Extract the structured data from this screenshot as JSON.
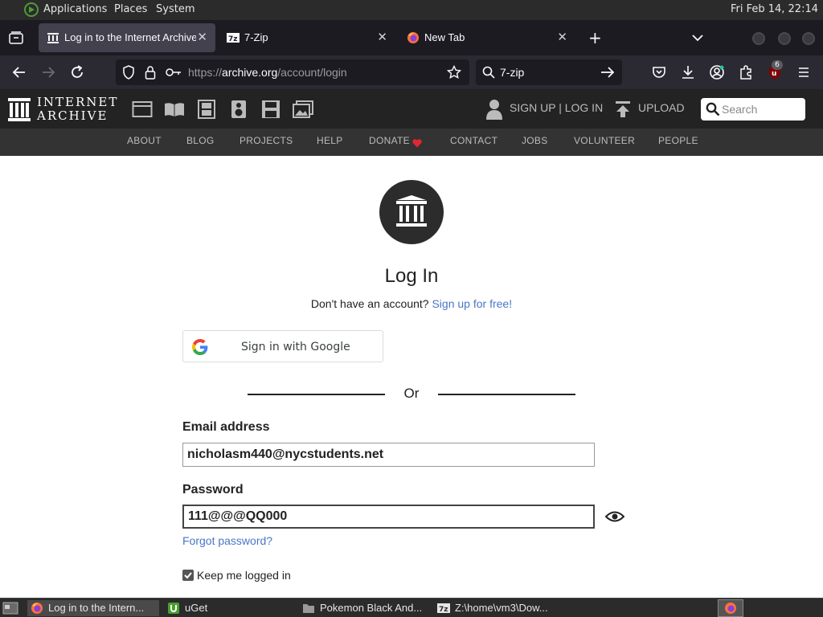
{
  "top_panel": {
    "menus": [
      "Applications",
      "Places",
      "System"
    ],
    "clock": "Fri Feb 14, 22:14"
  },
  "browser": {
    "tabs": [
      {
        "title": "Log in to the Internet Archive",
        "active": true,
        "icon": "archive-icon"
      },
      {
        "title": "7-Zip",
        "active": false,
        "icon": "7zip-icon"
      },
      {
        "title": "New Tab",
        "active": false,
        "icon": "firefox-icon"
      }
    ],
    "url_prefix": "https://",
    "url_host": "archive.org",
    "url_path": "/account/login",
    "search_query": "7-zip",
    "extension_badge": "6"
  },
  "ia_header": {
    "logo_line1": "INTERNET",
    "logo_line2": "ARCHIVE",
    "media_icons": [
      "web-icon",
      "texts-icon",
      "video-icon",
      "audio-icon",
      "software-icon",
      "images-icon"
    ],
    "signup_login": "SIGN UP | LOG IN",
    "upload": "UPLOAD",
    "search_placeholder": "Search",
    "subnav": [
      "ABOUT",
      "BLOG",
      "PROJECTS",
      "HELP",
      "DONATE",
      "CONTACT",
      "JOBS",
      "VOLUNTEER",
      "PEOPLE"
    ]
  },
  "login": {
    "title": "Log In",
    "no_account": "Don't have an account?",
    "signup_link": "Sign up for free!",
    "google_button": "Sign in with Google",
    "or": "Or",
    "email_label": "Email address",
    "email_value": "nicholasm440@nycstudents.net",
    "password_label": "Password",
    "password_value": "111@@@QQ000",
    "forgot": "Forgot password?",
    "keep_logged_in": "Keep me logged in",
    "keep_checked": true
  },
  "taskbar": {
    "items": [
      {
        "title": "Log in to the Intern...",
        "icon": "firefox-icon",
        "active": true
      },
      {
        "title": "uGet",
        "icon": "uget-icon",
        "active": false
      },
      {
        "title": "Pokemon Black And...",
        "icon": "folder-icon",
        "active": false
      },
      {
        "title": "Z:\\home\\vm3\\Dow...",
        "icon": "7zip-icon",
        "active": false
      }
    ]
  },
  "colors": {
    "ia_dark": "#232323",
    "ia_subnav": "#333333",
    "link_blue": "#4a76c7",
    "firefox_tabstrip": "#1c1b22",
    "firefox_toolbar": "#2b2a33"
  }
}
